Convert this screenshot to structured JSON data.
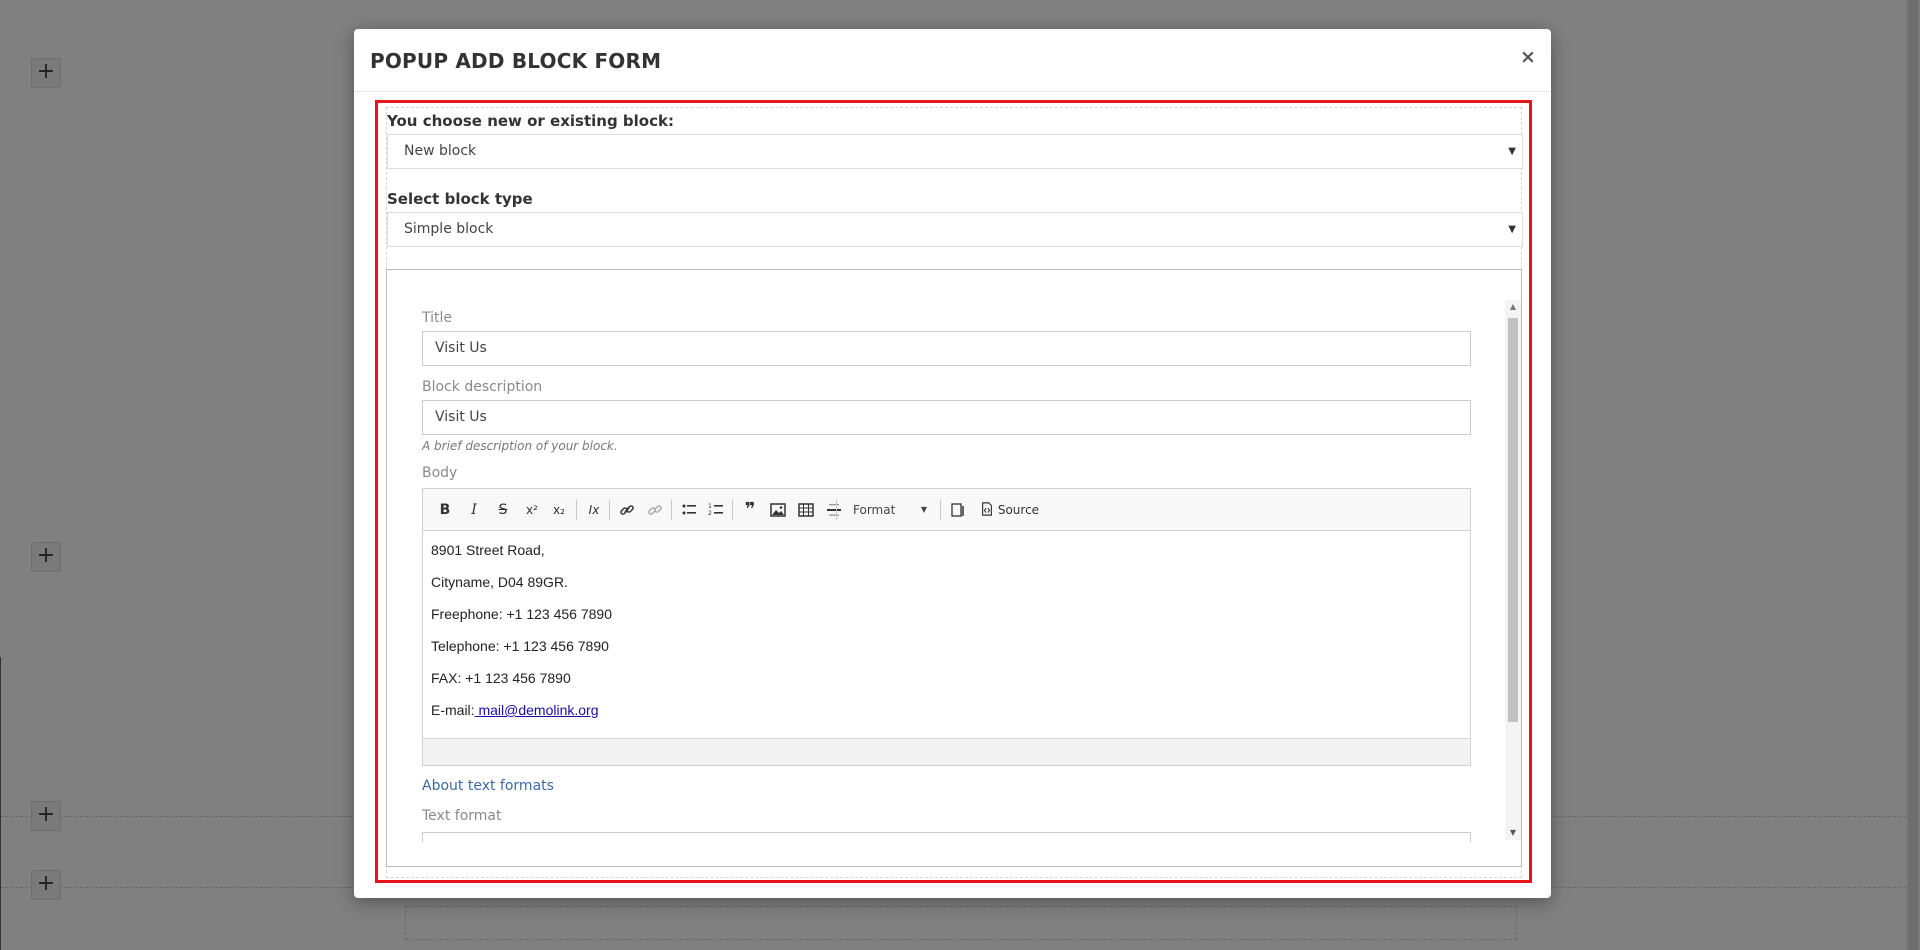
{
  "modal": {
    "title": "POPUP ADD BLOCK FORM",
    "close_label": "×"
  },
  "block_choice": {
    "label": "You choose new or existing block:",
    "selected": "New block"
  },
  "block_type": {
    "label": "Select block type",
    "selected": "Simple block"
  },
  "form": {
    "title_label": "Title",
    "title_value": "Visit Us",
    "description_label": "Block description",
    "description_value": "Visit Us",
    "description_help": "A brief description of your block.",
    "body_label": "Body",
    "about_formats": "About text formats",
    "text_format_label": "Text format"
  },
  "toolbar": {
    "bold": "B",
    "italic": "I",
    "strike": "S",
    "superscript": "x²",
    "subscript": "x₂",
    "remove_format": "Ix",
    "format_label": "Format",
    "source_label": "Source"
  },
  "editor_content": {
    "line1": "8901 Street Road,",
    "line2": "Cityname, D04 89GR.",
    "line3": "Freephone: +1 123 456 7890",
    "line4": "Telephone: +1 123 456 7890",
    "line5": "FAX: +1 123 456 7890",
    "email_prefix": "E-mail:",
    "email_link": " mail@demolink.org"
  },
  "background": {
    "add_symbol": "+"
  },
  "colors": {
    "highlight": "#e8141b",
    "overlay": "#808080",
    "link": "#3b6aa6"
  }
}
